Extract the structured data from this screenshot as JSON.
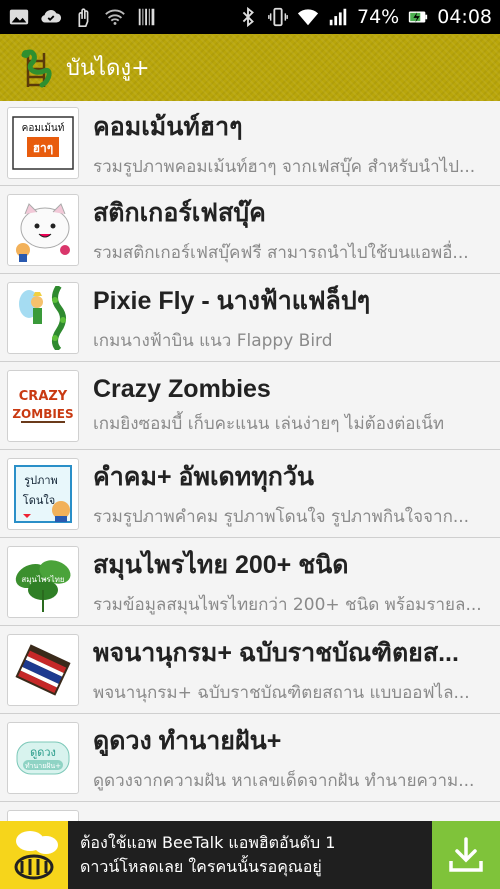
{
  "status_bar": {
    "battery": "74%",
    "time": "04:08",
    "icons": [
      "image-icon",
      "check-cloud-icon",
      "hand-icon",
      "wifi-icon",
      "barcode-icon",
      "bluetooth-icon",
      "vibrate-icon",
      "wifi-signal-icon",
      "cell-signal-icon",
      "battery-charging-icon"
    ]
  },
  "action_bar": {
    "title": "บันไดงู+",
    "logo_icon": "snake-ladder-icon"
  },
  "apps": [
    {
      "title": "คอมเม้นท์ฮาๆ",
      "desc": "รวมรูปภาพคอมเม้นท์ฮาๆ จากเฟสบุ๊ค สำหรับนำไป...",
      "thumb_label": "คอมเม้นท์ ฮาๆ"
    },
    {
      "title": "สติกเกอร์เฟสบุ๊ค",
      "desc": "รวมสติกเกอร์เฟสบุ๊คฟรี สามารถนำไปใช้บนแอพอื่...",
      "thumb_label": ""
    },
    {
      "title": "Pixie Fly - นางฟ้าแฟล็ปๆ",
      "desc": "เกมนางฟ้าบิน แนว Flappy Bird",
      "thumb_label": ""
    },
    {
      "title": "Crazy Zombies",
      "desc": "เกมยิงซอมบี้ เก็บคะแนน เล่นง่ายๆ ไม่ต้องต่อเน็ท",
      "thumb_label": "CRAZY ZOMBIES"
    },
    {
      "title": "คำคม+ อัพเดททุกวัน",
      "desc": "รวมรูปภาพคำคม รูปภาพโดนใจ รูปภาพกินใจจาก...",
      "thumb_label": "รูปภาพ โดนใจ"
    },
    {
      "title": "สมุนไพรไทย 200+ ชนิด",
      "desc": "รวมข้อมูลสมุนไพรไทยกว่า 200+ ชนิด พร้อมรายล...",
      "thumb_label": "สมุนไพรไทย"
    },
    {
      "title": "พจนานุกรม+ ฉบับราชบัณฑิตยส...",
      "desc": "พจนานุกรม+ ฉบับราชบัณฑิตยสถาน แบบออฟไล...",
      "thumb_label": ""
    },
    {
      "title": "ดูดวง ทำนายฝัน+",
      "desc": "ดูดวงจากความฝัน หาเลขเด็ดจากฝัน ทำนายความ...",
      "thumb_label": "ดูดวง ทำนายฝัน+"
    },
    {
      "title": "",
      "desc": "",
      "thumb_label": ""
    }
  ],
  "ad": {
    "line1": "ต้องใช้แอพ BeeTalk แอพฮิตอันดับ 1",
    "line2": "ดาวน์โหลดเลย ใครคนนั้นรอคุณอยู่",
    "logo_icon": "beetalk-logo-icon",
    "download_icon": "download-icon",
    "colors": {
      "logo_bg": "#f6d51b",
      "download_bg": "#7fc33a"
    }
  }
}
